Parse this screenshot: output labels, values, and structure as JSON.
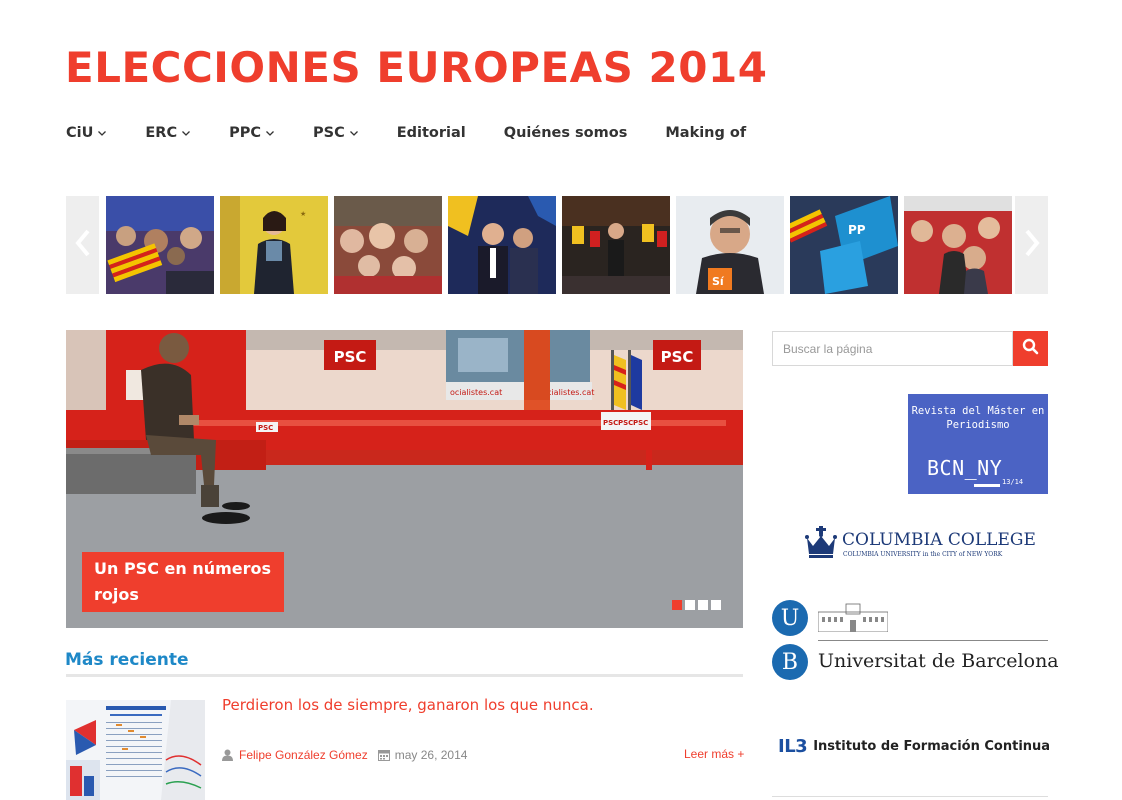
{
  "site": {
    "title": "ELECCIONES EUROPEAS 2014"
  },
  "nav": {
    "items": [
      {
        "label": "CiU",
        "has_dropdown": true
      },
      {
        "label": "ERC",
        "has_dropdown": true
      },
      {
        "label": "PPC",
        "has_dropdown": true
      },
      {
        "label": "PSC",
        "has_dropdown": true
      },
      {
        "label": "Editorial",
        "has_dropdown": false
      },
      {
        "label": "Quiénes somos",
        "has_dropdown": false
      },
      {
        "label": "Making of",
        "has_dropdown": false
      }
    ]
  },
  "carousel": {
    "prev_icon": "chevron-left-icon",
    "next_icon": "chevron-right-icon",
    "thumbnails": [
      {
        "name": "rally-crowd-flags"
      },
      {
        "name": "woman-yellow-stage"
      },
      {
        "name": "elderly-audience"
      },
      {
        "name": "candidates-with-flags"
      },
      {
        "name": "candidate-on-stage"
      },
      {
        "name": "candidate-si-sign"
      },
      {
        "name": "blue-flags-rally"
      },
      {
        "name": "crowd-with-candidate"
      }
    ]
  },
  "hero": {
    "caption": "Un PSC en números rojos",
    "slide_count": 4,
    "active_slide": 1,
    "scene_text": {
      "logo1": "PSC",
      "logo2": "PSC",
      "banner": "ocialistes.cat",
      "banner2": "socialistes.cat",
      "podium1": "PSC",
      "podium2": "PSC",
      "podium3": "PSC",
      "wall": "PSC"
    }
  },
  "recent": {
    "heading": "Más reciente",
    "posts": [
      {
        "title": "Perdieron los de siempre, ganaron los que nunca.",
        "author": "Felipe González Gómez",
        "date": "may 26, 2014",
        "read_more": "Leer más +"
      }
    ]
  },
  "sidebar": {
    "search": {
      "placeholder": "Buscar la página",
      "button_icon": "search-icon"
    },
    "banner_bcn": {
      "text": "Revista del Máster en Periodismo",
      "title": "BCN_NY",
      "subtitle": "13/14"
    },
    "columbia": {
      "name": "COLUMBIA COLLEGE",
      "sub": "COLUMBIA UNIVERSITY in the CITY of NEW YORK"
    },
    "ub": {
      "letter1": "U",
      "letter2": "B",
      "name": "Universitat de Barcelona"
    },
    "il3": {
      "mark": "IL3",
      "name": "Instituto de Formación Continua"
    }
  },
  "colors": {
    "accent": "#ef3e2d",
    "link_blue": "#1e88c7",
    "banner_blue": "#4b63c4"
  }
}
